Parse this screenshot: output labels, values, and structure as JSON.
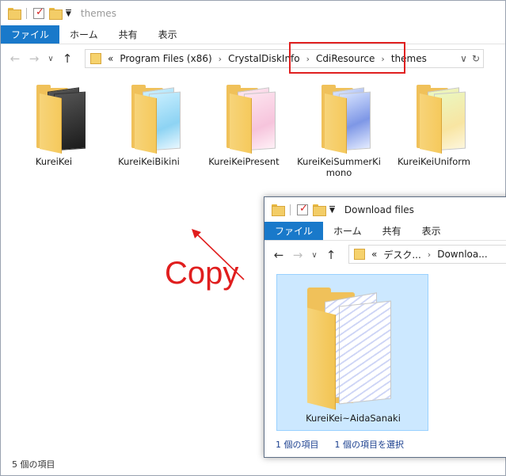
{
  "main_window": {
    "title": "themes",
    "ribbon_tabs": [
      "ファイル",
      "ホーム",
      "共有",
      "表示"
    ],
    "breadcrumb": [
      "«",
      "Program Files (x86)",
      "CrystalDiskInfo",
      "CdiResource",
      "themes"
    ],
    "items": [
      {
        "name": "KureiKei",
        "style": "dark"
      },
      {
        "name": "KureiKeiBikini",
        "style": "bikini"
      },
      {
        "name": "KureiKeiPresent",
        "style": "present"
      },
      {
        "name": "KureiKeiSummerKimono",
        "style": "kimono"
      },
      {
        "name": "KureiKeiUniform",
        "style": "uniform"
      }
    ],
    "status": "5 個の項目"
  },
  "download_window": {
    "title": "Download files",
    "ribbon_tabs": [
      "ファイル",
      "ホーム",
      "共有",
      "表示"
    ],
    "breadcrumb": [
      "«",
      "デスク...",
      "Downloa..."
    ],
    "item": {
      "name": "KureiKei~AidaSanaki"
    },
    "status_count": "1 個の項目",
    "status_selected": "1 個の項目を選択"
  },
  "annotation": {
    "label": "Copy",
    "color": "#e01e1e"
  },
  "colors": {
    "file_tab": "#1979ca",
    "selection": "#cce8ff"
  }
}
